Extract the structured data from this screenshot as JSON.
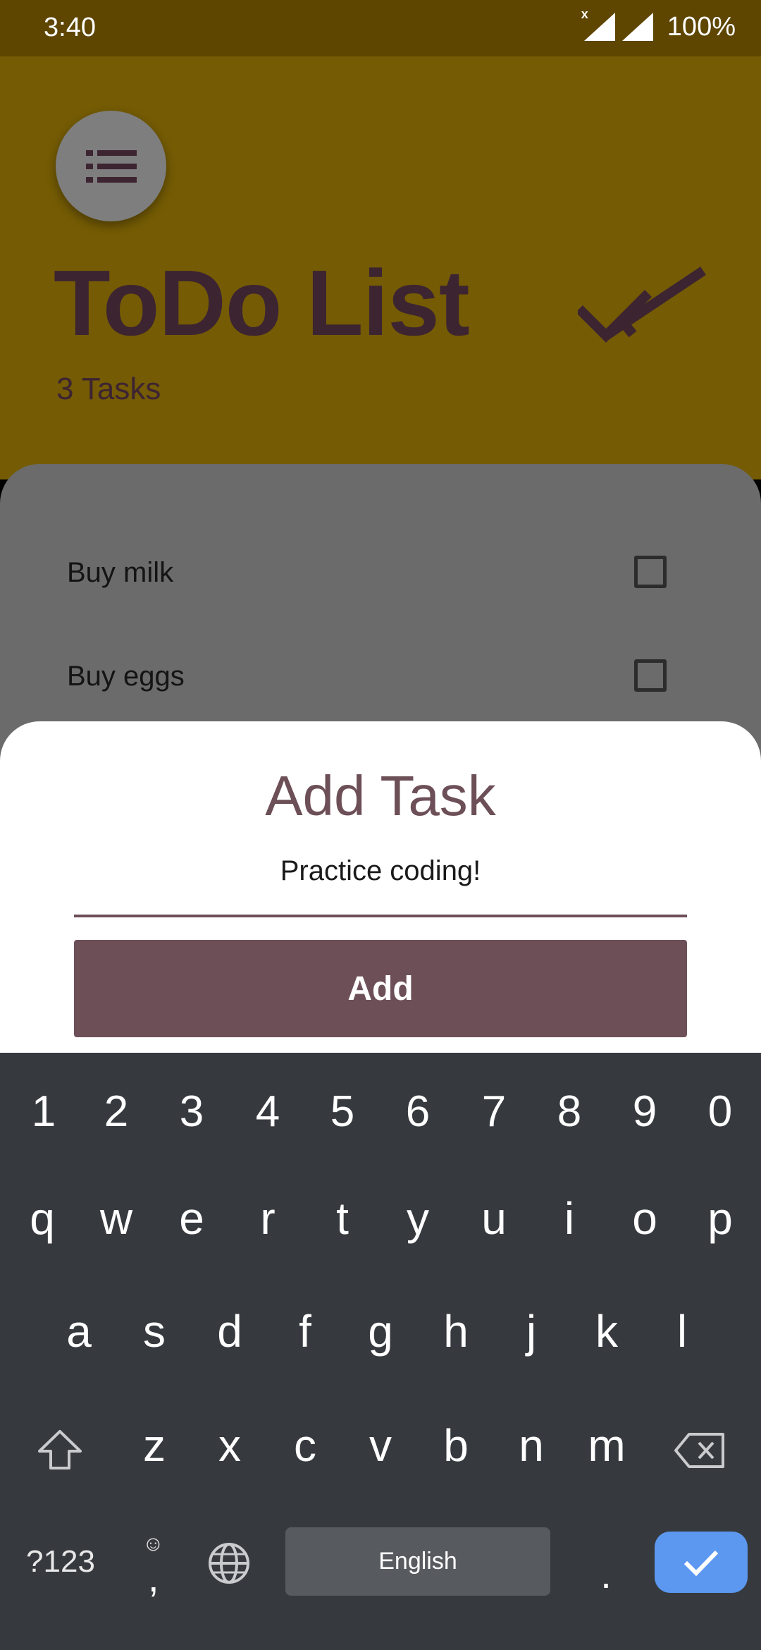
{
  "status_bar": {
    "time": "3:40",
    "battery": "100%",
    "sim_mark": "x"
  },
  "app": {
    "title": "ToDo List",
    "task_count": "3 Tasks",
    "tasks": [
      {
        "label": "Buy milk",
        "checked": false
      },
      {
        "label": "Buy eggs",
        "checked": false
      }
    ]
  },
  "sheet": {
    "title": "Add Task",
    "input_value": "Practice coding!",
    "add_label": "Add"
  },
  "keyboard": {
    "numbers": [
      "1",
      "2",
      "3",
      "4",
      "5",
      "6",
      "7",
      "8",
      "9",
      "0"
    ],
    "row1": [
      "q",
      "w",
      "e",
      "r",
      "t",
      "y",
      "u",
      "i",
      "o",
      "p"
    ],
    "row2": [
      "a",
      "s",
      "d",
      "f",
      "g",
      "h",
      "j",
      "k",
      "l"
    ],
    "row3": [
      "z",
      "x",
      "c",
      "v",
      "b",
      "n",
      "m"
    ],
    "symbols_label": "?123",
    "comma_label": ",",
    "emoji_hint": "☺",
    "space_label": "English",
    "period_label": "."
  },
  "colors": {
    "status_bar": "#5e4601",
    "header": "#745b04",
    "accent": "#6d4f58",
    "keyboard": "#363a3f",
    "enter": "#5c97f0"
  }
}
